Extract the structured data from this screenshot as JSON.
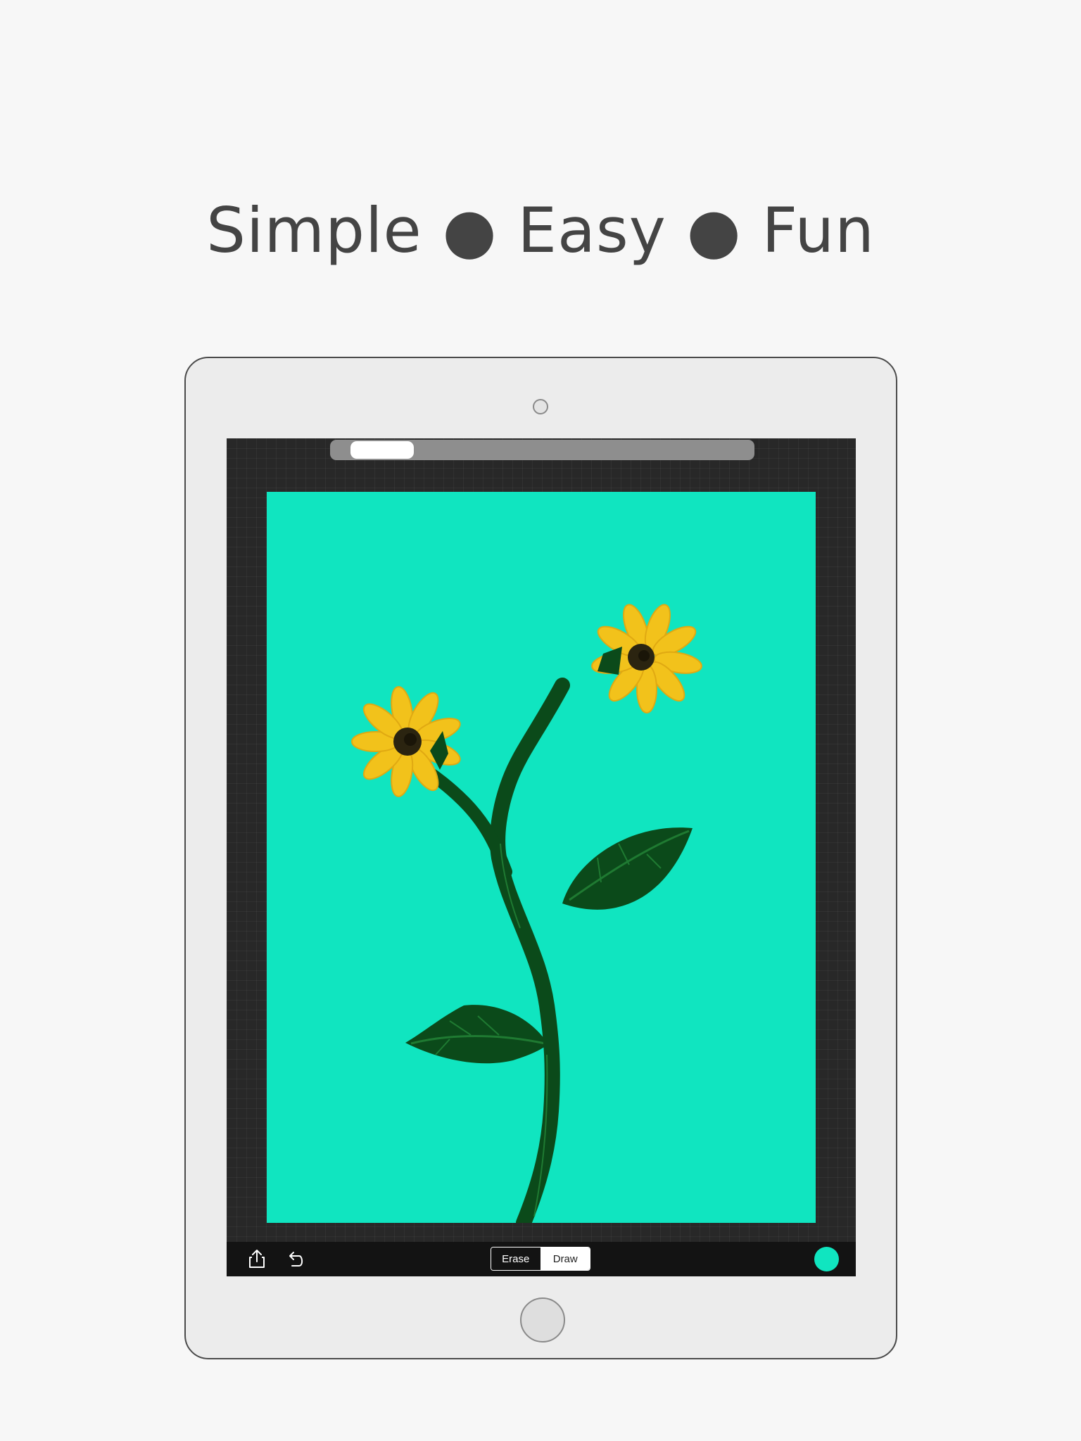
{
  "headline": {
    "text": "Simple ● Easy ● Fun"
  },
  "canvas": {
    "paper_color": "#10e5c0",
    "drawing": "sunflower illustration"
  },
  "toolbar": {
    "share_icon": "share-icon",
    "undo_icon": "undo-icon",
    "mode": {
      "erase_label": "Erase",
      "draw_label": "Draw",
      "selected": "Draw"
    },
    "current_color": "#10e5c0"
  },
  "colors": {
    "background": "#f7f7f7",
    "device_frame": "#ececec",
    "screen": "#282828",
    "toolbar": "#131313",
    "petal": "#f2c21b",
    "stem": "#0b4a1a"
  }
}
